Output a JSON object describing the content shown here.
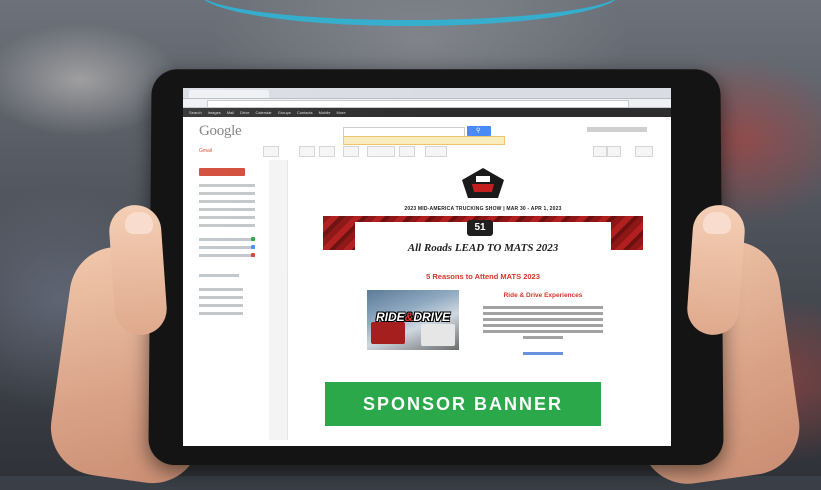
{
  "gmail": {
    "logo": "Google",
    "label": "Gmail",
    "topbar": [
      "Search",
      "Images",
      "Mail",
      "Drive",
      "Calendar",
      "Groups",
      "Contacts",
      "Mobile",
      "More"
    ]
  },
  "email": {
    "event_line": "2023 MID-AMERICA TRUCKING SHOW  |  MAR 30 - APR 1, 2023",
    "badge_number": "51",
    "headline": "All Roads LEAD TO MATS 2023",
    "reasons_title": "5 Reasons to Attend MATS 2023",
    "ride_label_1": "RIDE",
    "ride_label_amp": "&",
    "ride_label_2": "DRIVE",
    "section_title": "Ride & Drive Experiences",
    "sponsor_banner": "SPONSOR BANNER"
  },
  "colors": {
    "sponsor_green": "#2aa84a",
    "accent_red": "#d9352b",
    "gmail_red": "#d14836",
    "google_blue": "#4a8af4"
  }
}
